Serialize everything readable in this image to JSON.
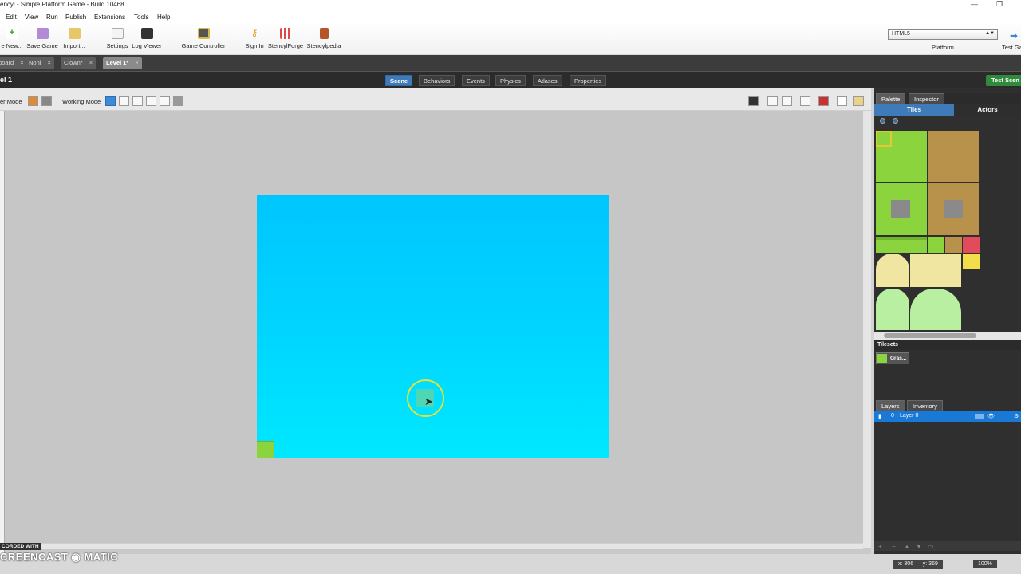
{
  "window": {
    "title": "encyl - Simple Platform Game - Build 10468",
    "controls": [
      "—",
      "❐"
    ]
  },
  "menu": [
    "Edit",
    "View",
    "Run",
    "Publish",
    "Extensions",
    "Tools",
    "Help"
  ],
  "toolbar": {
    "items": [
      {
        "label": "e New...",
        "icon": "create-new-icon"
      },
      {
        "label": "Save Game",
        "icon": "save-icon"
      },
      {
        "label": "Import...",
        "icon": "import-icon"
      },
      {
        "label": "Settings",
        "icon": "settings-icon"
      },
      {
        "label": "Log Viewer",
        "icon": "log-viewer-icon"
      },
      {
        "label": "Game Controller",
        "icon": "game-controller-icon"
      },
      {
        "label": "Sign In",
        "icon": "key-icon"
      },
      {
        "label": "StencylForge",
        "icon": "store-icon"
      },
      {
        "label": "Stencylpedia",
        "icon": "book-icon"
      }
    ],
    "platform_select_value": "HTML5",
    "platform_label": "Platform",
    "test_game_label": "Test Ga"
  },
  "doc_tabs": [
    {
      "label": "board",
      "active": false
    },
    {
      "label": "Noni",
      "active": false
    },
    {
      "label": "Clown*",
      "active": false
    },
    {
      "label": "Level 1*",
      "active": true
    }
  ],
  "scene": {
    "title": "el 1",
    "tabs": [
      "Scene",
      "Behaviors",
      "Events",
      "Physics",
      "Atlases",
      "Properties"
    ],
    "active_tab": "Scene",
    "test_scene_label": "Test Scen"
  },
  "modebar": {
    "left_mode_label": "er Mode",
    "working_mode_label": "Working Mode"
  },
  "right_panel": {
    "tabs": [
      "Palette",
      "Inspector"
    ],
    "subtabs": [
      "Tiles",
      "Actors"
    ],
    "tilesets_header": "Tilesets",
    "tileset_name": "Gras...",
    "layer_tabs": [
      "Layers",
      "Inventory"
    ],
    "layer_row": {
      "index": "0",
      "name": "Layer 0"
    }
  },
  "status": {
    "x_label": "x:",
    "x_value": "306",
    "y_label": "y:",
    "y_value": "369",
    "zoom": "100%"
  },
  "watermark": {
    "recorded": "CORDED WITH",
    "brand": "CREENCAST ◉ MATIC"
  },
  "colors": {
    "scene_top": "#00c6ff",
    "scene_bottom": "#00e8ff",
    "grass": "#8cd43e",
    "accent": "#3e7bb8"
  }
}
